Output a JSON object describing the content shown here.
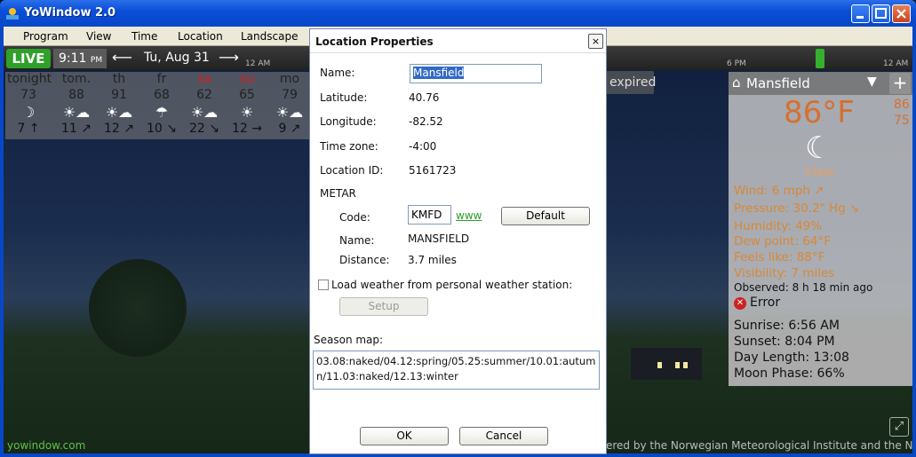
{
  "window": {
    "title": "YoWindow 2.0"
  },
  "menu": [
    "Program",
    "View",
    "Time",
    "Location",
    "Landscape"
  ],
  "timeline": {
    "live": "LIVE",
    "time": "9:11",
    "ampm": "PM",
    "date": "Tu, Aug 31",
    "prev_arrow": "⟵",
    "next_arrow": "⟶",
    "ticks": [
      "12 AM",
      "6 PM",
      "12 AM"
    ]
  },
  "forecast": [
    {
      "name": "tonight",
      "temp": "73",
      "icon": "☽",
      "wind": "7 ↑",
      "weekend": false
    },
    {
      "name": "tom.",
      "temp": "88",
      "icon": "☀☁",
      "wind": "11 ↗",
      "weekend": false
    },
    {
      "name": "th",
      "temp": "91",
      "icon": "☀☁",
      "wind": "12 ↗",
      "weekend": false
    },
    {
      "name": "fr",
      "temp": "68",
      "icon": "☂",
      "wind": "10 ↘",
      "weekend": false
    },
    {
      "name": "sa",
      "temp": "62",
      "icon": "☀☁",
      "wind": "22 ↘",
      "weekend": true
    },
    {
      "name": "su",
      "temp": "65",
      "icon": "☀",
      "wind": "12 →",
      "weekend": true
    },
    {
      "name": "mo",
      "temp": "79",
      "icon": "☀☁",
      "wind": "9 ↗",
      "weekend": false
    }
  ],
  "expired_label": "expired",
  "current": {
    "location": "Mansfield",
    "temp": "86°F",
    "high": "86",
    "low": "75",
    "condition": "Clear",
    "wind": "Wind:  6 mph    ↗",
    "pressure": "Pressure:  30.2\" Hg    ↘",
    "humidity": "Humidity:  49%",
    "dew_point": "Dew point:  64°F",
    "feels_like": "Feels like:  88°F",
    "visibility": "Visibility:  7 miles",
    "observed": "Observed:  8 h 18 min ago",
    "error": "Error",
    "sunrise": "Sunrise:  6:56 AM",
    "sunset": "Sunset:  8:04 PM",
    "day_length": "Day Length:  13:08",
    "moon_phase": "Moon Phase:  66%"
  },
  "footer": {
    "site": "yowindow.com",
    "credit": "ered by the Norwegian Meteorological Institute and the NRK"
  },
  "dialog": {
    "title": "Location Properties",
    "close": "×",
    "name_label": "Name:",
    "name_value": "Mansfield",
    "latitude_label": "Latitude:",
    "latitude": "40.76",
    "longitude_label": "Longitude:",
    "longitude": "-82.52",
    "timezone_label": "Time zone:",
    "timezone": "-4:00",
    "locid_label": "Location ID:",
    "locid": "5161723",
    "metar_label": "METAR",
    "code_label": "Code:",
    "code_value": "KMFD",
    "www_link": "www",
    "default_btn": "Default",
    "metar_name_label": "Name:",
    "metar_name": "MANSFIELD",
    "distance_label": "Distance:",
    "distance": "3.7  miles",
    "pws_label": "Load weather from personal weather station:",
    "setup_btn": "Setup",
    "season_label": "Season map:",
    "season_value": "03.08:naked/04.12:spring/05.25:summer/10.01:autumn/11.03:naked/12.13:winter",
    "ok_btn": "OK",
    "cancel_btn": "Cancel"
  }
}
